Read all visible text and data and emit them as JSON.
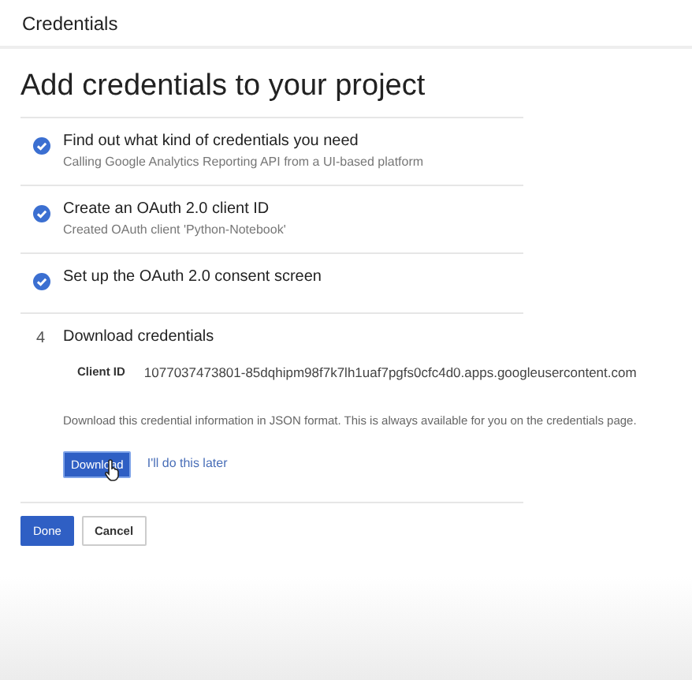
{
  "header": {
    "title": "Credentials"
  },
  "page_title": "Add credentials to your project",
  "steps": [
    {
      "kind": "done",
      "title": "Find out what kind of credentials you need",
      "subtitle": "Calling Google Analytics Reporting API from a UI-based platform"
    },
    {
      "kind": "done",
      "title": "Create an OAuth 2.0 client ID",
      "subtitle": "Created OAuth client 'Python-Notebook'"
    },
    {
      "kind": "done",
      "title": "Set up the OAuth 2.0 consent screen"
    },
    {
      "kind": "current",
      "number": "4",
      "title": "Download credentials"
    }
  ],
  "client_id": {
    "label": "Client ID",
    "value": "1077037473801-85dqhipm98f7k7lh1uaf7pgfs0cfc4d0.apps.googleusercontent.com"
  },
  "download_note": "Download this credential information in JSON format. This is always available for you on the credentials page.",
  "download_button": "Download",
  "later_link": "I'll do this later",
  "buttons": [
    {
      "label": "Done",
      "kind": "primary"
    },
    {
      "label": "Cancel",
      "kind": "secondary"
    }
  ]
}
